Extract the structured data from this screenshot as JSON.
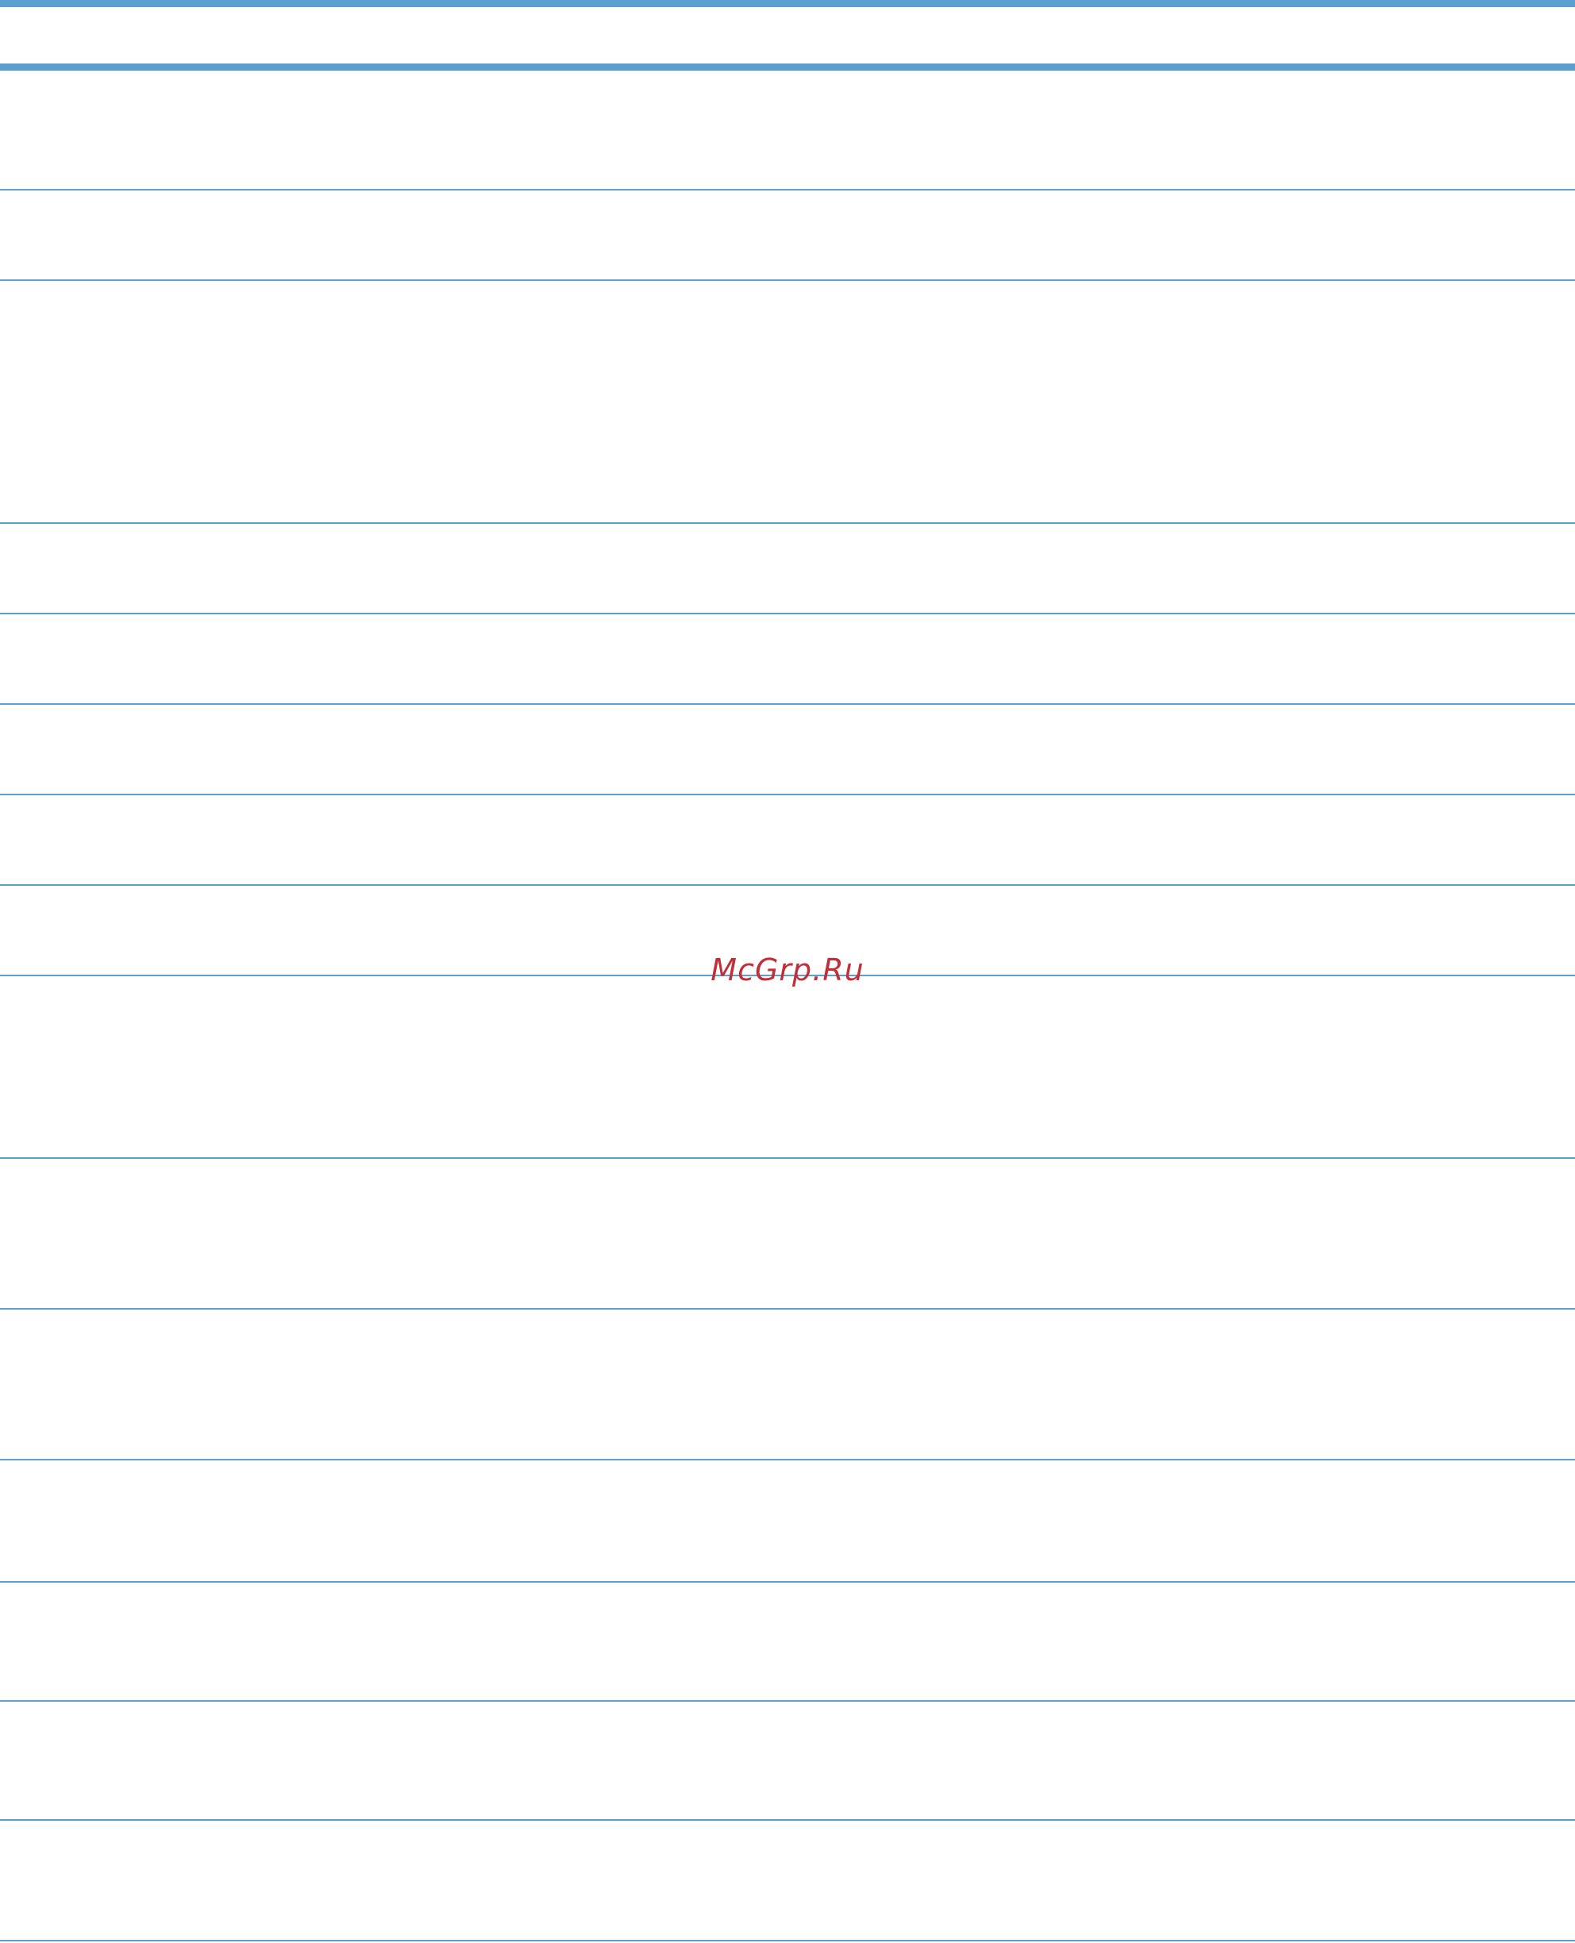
{
  "watermark": {
    "text": "McGrp.Ru"
  },
  "colors": {
    "rule": "#5b9fd0",
    "watermark": "#c0303a",
    "background": "#ffffff"
  },
  "table": {
    "rows": [
      {
        "cells": []
      },
      {
        "cells": []
      },
      {
        "cells": []
      },
      {
        "cells": []
      },
      {
        "cells": []
      },
      {
        "cells": []
      },
      {
        "cells": []
      },
      {
        "cells": []
      },
      {
        "cells": []
      },
      {
        "cells": []
      },
      {
        "cells": []
      },
      {
        "cells": []
      },
      {
        "cells": []
      },
      {
        "cells": []
      },
      {
        "cells": []
      },
      {
        "cells": []
      }
    ]
  }
}
